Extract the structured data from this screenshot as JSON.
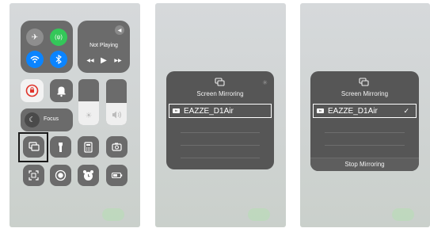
{
  "media": {
    "status": "Not Playing"
  },
  "focus": {
    "label": "Focus"
  },
  "mirroring": {
    "title": "Screen Mirroring",
    "device": "EAZZE_D1Air",
    "stop_label": "Stop Mirroring",
    "check": "✓",
    "tv_badge": "tv"
  },
  "icons": {
    "airplane": "✈",
    "cellular": "(ψ)",
    "wifi": "wifi-icon",
    "bluetooth": "bluetooth-icon",
    "airplay": "airplay-icon",
    "prev": "◀◀",
    "play": "▶",
    "next": "▶▶",
    "rotation_lock": "rotation-lock-icon",
    "bell": "bell-icon",
    "moon": "moon-icon",
    "brightness": "☀",
    "volume": "volume-icon",
    "flashlight": "flashlight-icon",
    "calculator": "calculator-icon",
    "camera": "camera-icon",
    "qr": "qr-scanner-icon",
    "record": "screen-record-icon",
    "alarm": "alarm-icon",
    "battery": "battery-icon"
  },
  "colors": {
    "orange": "#f08a2d",
    "green": "#34c759",
    "blue": "#0a84ff",
    "selection_border": "#1a1a1a"
  },
  "levels": {
    "brightness": 0.52,
    "volume": 0.48
  }
}
